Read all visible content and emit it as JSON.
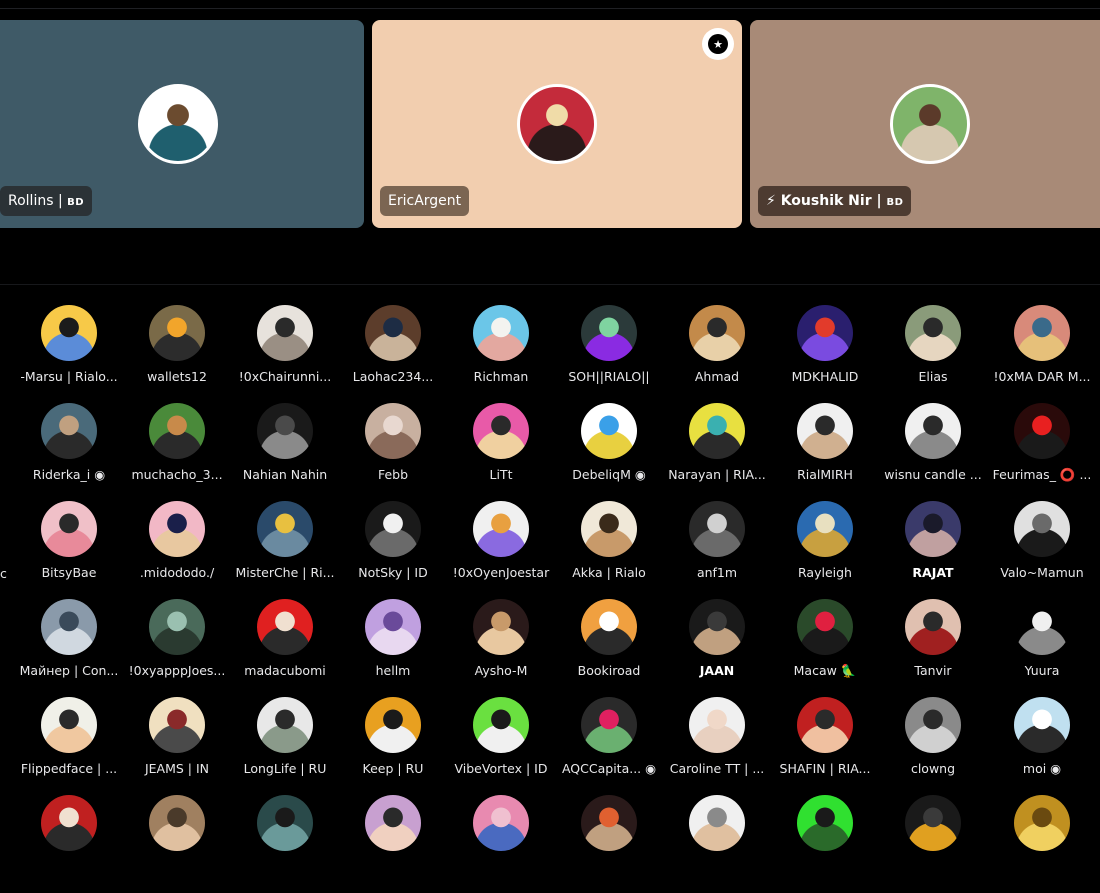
{
  "featured": [
    {
      "name": "Rollins | ",
      "tag": "BD",
      "bg": "#3f5a67",
      "tagbg": "#2b3236",
      "avatar_colors": [
        "#ffffff",
        "#6b4b2f",
        "#1f5f6e"
      ]
    },
    {
      "name": "EricArgent",
      "tag": "",
      "bg": "#f2ceaf",
      "tagbg": "#7b6552",
      "avatar_colors": [
        "#c42b3b",
        "#f0dca8",
        "#2a1a1a"
      ]
    },
    {
      "name": "⚡ Koushik Nir | ",
      "tag": "BD",
      "bg": "#a88a77",
      "tagbg": "#4d3b31",
      "avatar_colors": [
        "#7fb46a",
        "#5b3a2a",
        "#d6c8b0"
      ]
    }
  ],
  "badge_icon": "star-badge-icon",
  "partial_label": "c",
  "members": [
    {
      "label": "-Marsu | Rialo...",
      "c": [
        "#f7c948",
        "#1b1b1b",
        "#5b8cd8"
      ]
    },
    {
      "label": "wallets12",
      "c": [
        "#7a6a48",
        "#f2a52b",
        "#2c2c2c"
      ]
    },
    {
      "label": "!0xChairunni...",
      "c": [
        "#e7e2dc",
        "#2a2a2a",
        "#9a8f84"
      ]
    },
    {
      "label": "Laohac234...",
      "c": [
        "#5c3d2b",
        "#1d2c44",
        "#c9b39a"
      ]
    },
    {
      "label": "Richman",
      "c": [
        "#6bc6e8",
        "#f3f3f0",
        "#e3a8a0"
      ]
    },
    {
      "label": "SOH||RIALO||",
      "c": [
        "#2b3a3a",
        "#7fd3a0",
        "#8a2be2"
      ]
    },
    {
      "label": "Ahmad",
      "c": [
        "#c38a4a",
        "#2a2a2a",
        "#e8d0a8"
      ]
    },
    {
      "label": "MDKHALID",
      "c": [
        "#2a1f6e",
        "#e23b2b",
        "#7a4be0"
      ]
    },
    {
      "label": "Elias",
      "c": [
        "#8a9b7a",
        "#2a2a2a",
        "#e6d6c0"
      ]
    },
    {
      "label": "!0xMA DAR M...",
      "c": [
        "#d88a7a",
        "#3a6a8a",
        "#e6c07a"
      ]
    },
    {
      "label": "Riderka_i ◉",
      "c": [
        "#4a6a7a",
        "#c0a080",
        "#2a2a2a"
      ]
    },
    {
      "label": "muchacho_3...",
      "c": [
        "#4a8a3a",
        "#c88a4a",
        "#2a2a2a"
      ]
    },
    {
      "label": "Nahian Nahin",
      "c": [
        "#1a1a1a",
        "#4a4a4a",
        "#8a8a8a"
      ]
    },
    {
      "label": "Febb",
      "c": [
        "#c8b0a0",
        "#e8d8d0",
        "#8a6a5a"
      ]
    },
    {
      "label": "LiTt",
      "c": [
        "#e85aa8",
        "#2a2a2a",
        "#f0d0a0"
      ]
    },
    {
      "label": "DebeliqM ◉",
      "c": [
        "#ffffff",
        "#3aa0e8",
        "#e8d040"
      ]
    },
    {
      "label": "Narayan | RIA...",
      "c": [
        "#e8e040",
        "#3ab0b0",
        "#2a2a2a"
      ]
    },
    {
      "label": "RialMIRH",
      "c": [
        "#f0f0f0",
        "#2a2a2a",
        "#d0b090"
      ]
    },
    {
      "label": "wisnu candle ...",
      "c": [
        "#f0f0f0",
        "#2a2a2a",
        "#8a8a8a"
      ]
    },
    {
      "label": "Feurimas_ ⭕ ...",
      "c": [
        "#2a0a0a",
        "#e82020",
        "#1a1a1a"
      ]
    },
    {
      "label": "BitsyBae",
      "c": [
        "#f0c0c8",
        "#2a2a2a",
        "#e88a9a"
      ]
    },
    {
      "label": ".midododo./",
      "c": [
        "#f2b8c6",
        "#1a1f4a",
        "#e8c8a0"
      ]
    },
    {
      "label": "MisterChe | Ri...",
      "c": [
        "#2a4a6a",
        "#e8c040",
        "#6a8aa0"
      ]
    },
    {
      "label": "NotSky | ID",
      "c": [
        "#1a1a1a",
        "#f0f0f0",
        "#6a6a6a"
      ]
    },
    {
      "label": "!0xOyenJoestar",
      "c": [
        "#f0f0f0",
        "#e8a040",
        "#8a6ae0"
      ]
    },
    {
      "label": "Akka | Rialo",
      "c": [
        "#f0e8d8",
        "#3a2a1a",
        "#c89a6a"
      ]
    },
    {
      "label": "anf1m",
      "c": [
        "#2a2a2a",
        "#d0d0d0",
        "#6a6a6a"
      ]
    },
    {
      "label": "Rayleigh",
      "c": [
        "#2a6ab0",
        "#e8e0c0",
        "#c8a040"
      ]
    },
    {
      "label": "RAJAT",
      "c": [
        "#3a3a6a",
        "#1a1a2a",
        "#c0a0a0"
      ],
      "bold": true
    },
    {
      "label": "Valo~Mamun",
      "c": [
        "#e0e0e0",
        "#6a6a6a",
        "#1a1a1a"
      ]
    },
    {
      "label": "Майнер | Con...",
      "c": [
        "#8a9aaa",
        "#3a4a5a",
        "#d0d8e0"
      ]
    },
    {
      "label": "!0xyapppJoes...",
      "c": [
        "#4a6a5a",
        "#9ac0b0",
        "#2a3a30"
      ]
    },
    {
      "label": "madacubomi",
      "c": [
        "#e02020",
        "#f0e0d0",
        "#2a2a2a"
      ]
    },
    {
      "label": "hellm",
      "c": [
        "#c0a0e0",
        "#6a4a9a",
        "#e8d8f0"
      ]
    },
    {
      "label": "Aysho-M",
      "c": [
        "#2a1a1a",
        "#c89a6a",
        "#e8c8a0"
      ]
    },
    {
      "label": "Bookiroad",
      "c": [
        "#f0a040",
        "#ffffff",
        "#2a2a2a"
      ]
    },
    {
      "label": "JAAN",
      "c": [
        "#1a1a1a",
        "#3a3a3a",
        "#c0a080"
      ],
      "bold": true
    },
    {
      "label": "Macaw 🦜",
      "c": [
        "#2a4a2a",
        "#e02040",
        "#1a1a1a"
      ]
    },
    {
      "label": "Tanvir",
      "c": [
        "#e0c0b0",
        "#2a2a2a",
        "#a02020"
      ]
    },
    {
      "label": "Yuura",
      "c": [
        "#000000",
        "#f0f0f0",
        "#8a8a8a"
      ]
    },
    {
      "label": "Flippedface | ...",
      "c": [
        "#f0f0e8",
        "#2a2a2a",
        "#f0c8a0"
      ]
    },
    {
      "label": "JEAMS | IN",
      "c": [
        "#f0e0c0",
        "#8a2a2a",
        "#4a4a4a"
      ]
    },
    {
      "label": "LongLife | RU",
      "c": [
        "#e8e8e8",
        "#2a2a2a",
        "#8a9a8a"
      ]
    },
    {
      "label": "Keep | RU",
      "c": [
        "#e8a020",
        "#1a1a1a",
        "#f0f0f0"
      ]
    },
    {
      "label": "VibeVortex | ID",
      "c": [
        "#6ae040",
        "#1a1a1a",
        "#f0f0f0"
      ]
    },
    {
      "label": "AQCCapita... ◉",
      "c": [
        "#2a2a2a",
        "#e02060",
        "#6ab070"
      ]
    },
    {
      "label": "Caroline TT | ...",
      "c": [
        "#f0f0f0",
        "#f0d8c8",
        "#e8d0c0"
      ]
    },
    {
      "label": "SHAFIN | RIA...",
      "c": [
        "#c02020",
        "#2a2a2a",
        "#f0c0a0"
      ]
    },
    {
      "label": "clowng",
      "c": [
        "#8a8a8a",
        "#2a2a2a",
        "#d0d0d0"
      ]
    },
    {
      "label": "moi ◉",
      "c": [
        "#c0e0f0",
        "#ffffff",
        "#2a2a2a"
      ]
    },
    {
      "label": "",
      "c": [
        "#c02020",
        "#f0e0d0",
        "#2a2a2a"
      ]
    },
    {
      "label": "",
      "c": [
        "#a08060",
        "#4a3a2a",
        "#e0c0a0"
      ]
    },
    {
      "label": "",
      "c": [
        "#2a4a4a",
        "#1a1a1a",
        "#6a9a9a"
      ]
    },
    {
      "label": "",
      "c": [
        "#c8a0d0",
        "#2a2a2a",
        "#f0d0c0"
      ]
    },
    {
      "label": "",
      "c": [
        "#e88ab0",
        "#f0c0d0",
        "#4a6ac0"
      ]
    },
    {
      "label": "",
      "c": [
        "#2a1a1a",
        "#e06030",
        "#c0a080"
      ]
    },
    {
      "label": "",
      "c": [
        "#f0f0f0",
        "#8a8a8a",
        "#e0c0a0"
      ]
    },
    {
      "label": "",
      "c": [
        "#30e030",
        "#1a1a1a",
        "#2a6a2a"
      ]
    },
    {
      "label": "",
      "c": [
        "#1a1a1a",
        "#3a3a3a",
        "#e0a020"
      ]
    },
    {
      "label": "",
      "c": [
        "#c09020",
        "#6a4a10",
        "#f0d060"
      ]
    }
  ]
}
